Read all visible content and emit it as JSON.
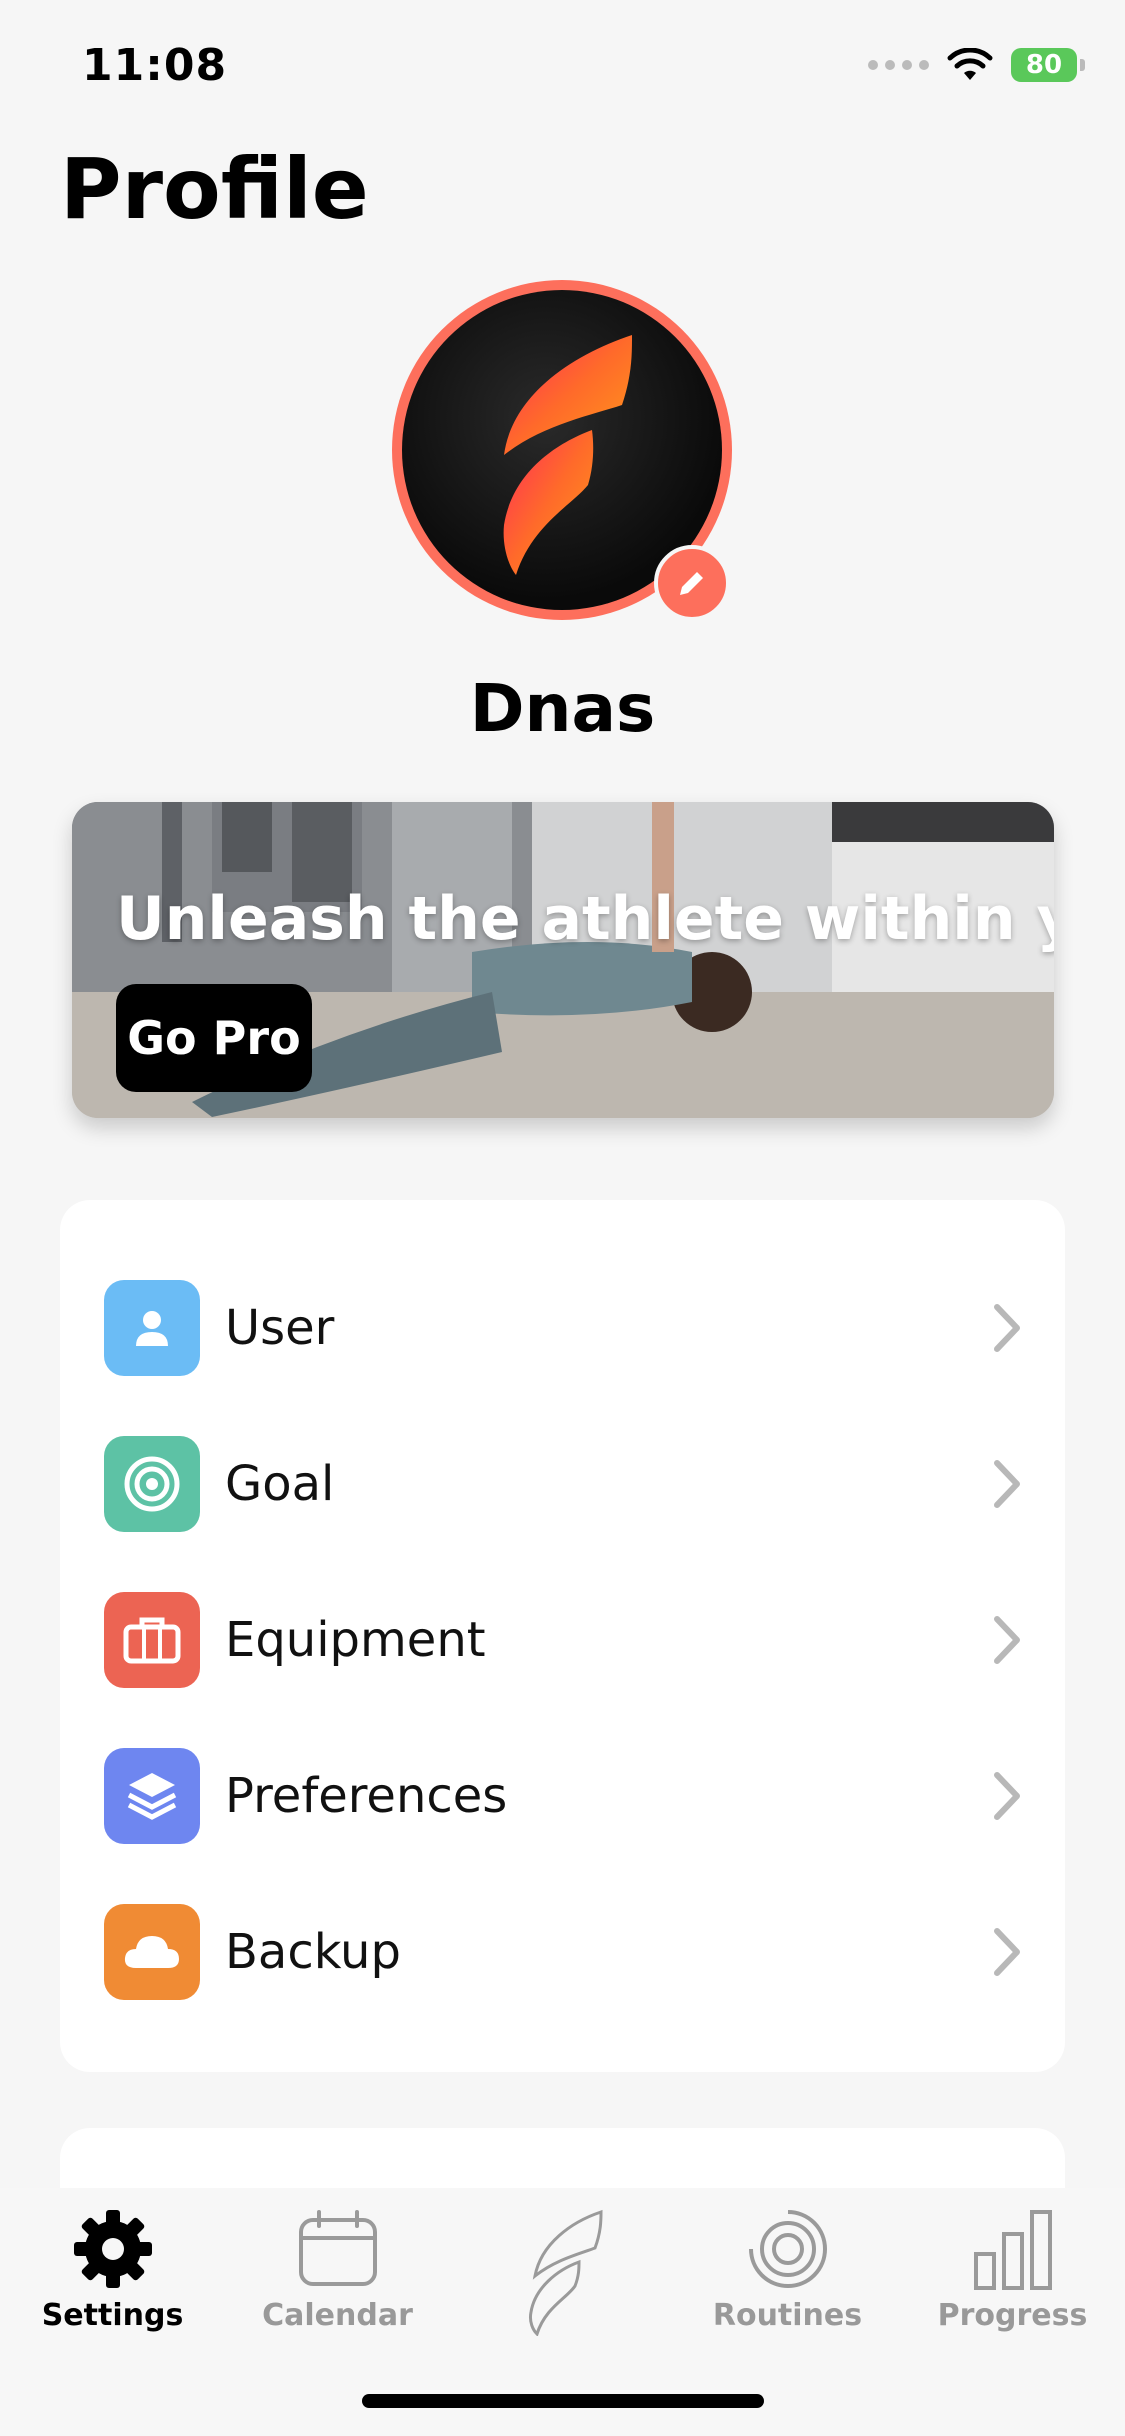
{
  "status_bar": {
    "time": "11:08",
    "battery": "80"
  },
  "header": {
    "title": "Profile"
  },
  "profile": {
    "name": "Dnas"
  },
  "promo": {
    "headline": "Unleash the athlete within you",
    "button_label": "Go Pro"
  },
  "settings": {
    "items": [
      {
        "label": "User",
        "icon": "person-icon",
        "color": "#6bbcf5"
      },
      {
        "label": "Goal",
        "icon": "target-icon",
        "color": "#5dc2a5"
      },
      {
        "label": "Equipment",
        "icon": "briefcase-icon",
        "color": "#ec6453"
      },
      {
        "label": "Preferences",
        "icon": "layers-icon",
        "color": "#6e86f0"
      },
      {
        "label": "Backup",
        "icon": "cloud-icon",
        "color": "#f08b34"
      }
    ]
  },
  "tab_bar": {
    "tabs": [
      {
        "label": "Settings",
        "icon": "gear-icon",
        "active": true
      },
      {
        "label": "Calendar",
        "icon": "calendar-icon"
      },
      {
        "label": "",
        "icon": "app-logo-icon"
      },
      {
        "label": "Routines",
        "icon": "routines-icon"
      },
      {
        "label": "Progress",
        "icon": "bar-chart-icon"
      }
    ]
  },
  "colors": {
    "accent": "#fd6f5c",
    "tab_active": "#000000",
    "tab_inactive": "#999999"
  }
}
